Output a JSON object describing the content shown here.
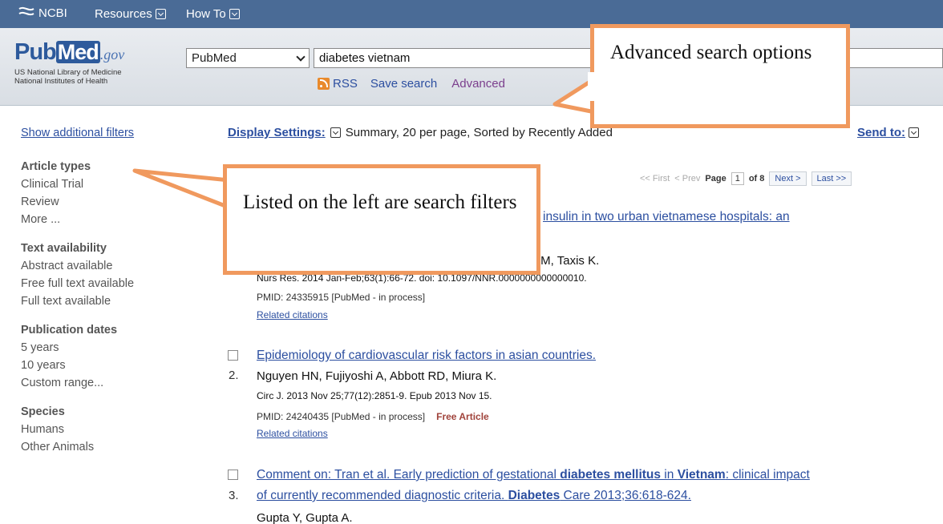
{
  "ncbi_bar": {
    "logo_text": "NCBI",
    "menu": [
      "Resources",
      "How To"
    ]
  },
  "brand": {
    "pub": "Pub",
    "med": "Med",
    "gov": ".gov",
    "org_line1": "US National Library of Medicine",
    "org_line2": "National Institutes of Health"
  },
  "search": {
    "database": "PubMed",
    "query": "diabetes vietnam",
    "links": {
      "rss": "RSS",
      "save": "Save search",
      "advanced": "Advanced"
    }
  },
  "filters": {
    "show_more": "Show additional filters",
    "groups": [
      {
        "title": "Article types",
        "items": [
          "Clinical Trial",
          "Review",
          "More ..."
        ]
      },
      {
        "title": "Text availability",
        "items": [
          "Abstract available",
          "Free full text available",
          "Full text available"
        ]
      },
      {
        "title": "Publication dates",
        "items": [
          "5 years",
          "10 years",
          "Custom range..."
        ]
      },
      {
        "title": "Species",
        "items": [
          "Humans",
          "Other Animals"
        ]
      }
    ]
  },
  "display": {
    "label": "Display Settings:",
    "value": "Summary, 20 per page, Sorted by Recently Added",
    "send_to": "Send to:"
  },
  "pager": {
    "first": "<< First",
    "prev": "< Prev",
    "page_label": "Page",
    "page": "1",
    "of": "of 8",
    "next": "Next >",
    "last": "Last >>"
  },
  "results": [
    {
      "title_visible": "insulin in two urban vietnamese hospitals: an",
      "authors_visible": "FM, Taxis K.",
      "cite_visible": "Nurs Res. 2014 Jan-Feb;63(1):66-72. doi: 10.1097/NNR.0000000000000010.",
      "pmid": "PMID: 24335915 [PubMed - in process]",
      "related": "Related citations"
    },
    {
      "number": "2.",
      "title": "Epidemiology of cardiovascular risk factors in asian countries.",
      "authors": "Nguyen HN, Fujiyoshi A, Abbott RD, Miura K.",
      "cite": "Circ J. 2013 Nov 25;77(12):2851-9. Epub 2013 Nov 15.",
      "pmid": "PMID: 24240435 [PubMed - in process]",
      "free": "Free Article",
      "related": "Related citations"
    },
    {
      "number": "3.",
      "title_parts": [
        "Comment on: Tran et al. Early prediction of gestational ",
        "diabetes mellitus",
        " in ",
        "Vietnam",
        ": clinical impact"
      ],
      "title_line2_parts": [
        "of currently recommended diagnostic criteria. ",
        "Diabetes",
        " Care 2013;36:618-624."
      ],
      "authors": "Gupta Y, Gupta A."
    }
  ],
  "callouts": {
    "advanced": "Advanced search options",
    "filters": "Listed on the left are search filters"
  },
  "colors": {
    "callout_border": "#f0995e",
    "ncbi_bar": "#4a6b96",
    "link": "#2c4fa0"
  }
}
